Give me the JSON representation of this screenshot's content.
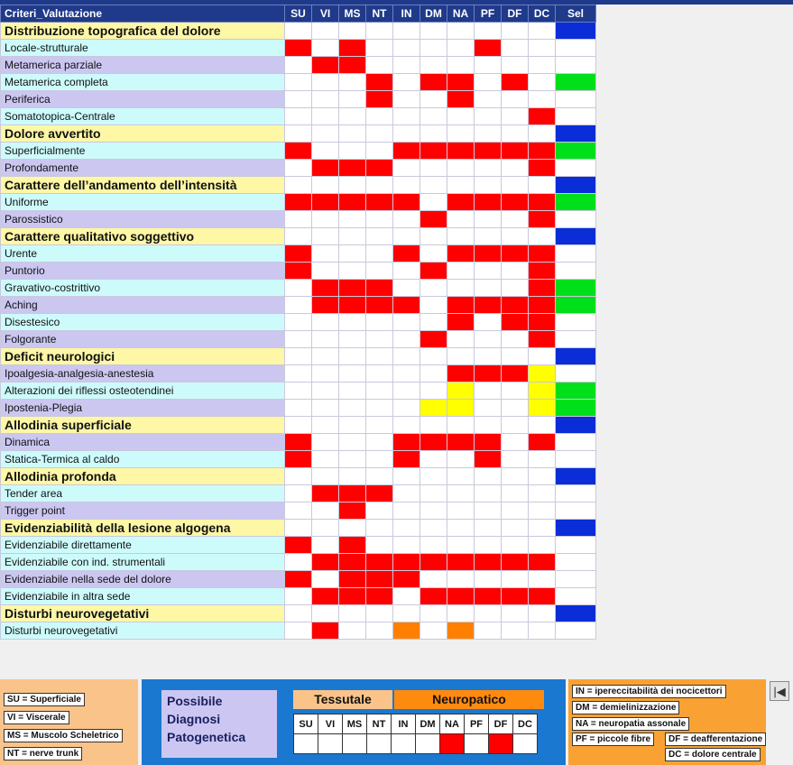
{
  "header": {
    "criteria_label": "Criteri_Valutazione",
    "columns": [
      "SU",
      "VI",
      "MS",
      "NT",
      "IN",
      "DM",
      "NA",
      "PF",
      "DF",
      "DC",
      "Sel"
    ]
  },
  "rows": [
    {
      "label": "Distribuzione topografica del dolore",
      "type": "section",
      "cells": "..........B"
    },
    {
      "label": "Locale-strutturale",
      "type": "a",
      "cells": "R.R....R..."
    },
    {
      "label": "Metamerica parziale",
      "type": "b",
      "cells": ".RR........"
    },
    {
      "label": "Metamerica completa",
      "type": "a",
      "cells": "...R.RR.R.G"
    },
    {
      "label": "Periferica",
      "type": "b",
      "cells": "...R..R...."
    },
    {
      "label": "Somatotopica-Centrale",
      "type": "a",
      "cells": ".........R."
    },
    {
      "label": "Dolore avvertito",
      "type": "section",
      "cells": "..........B"
    },
    {
      "label": "Superficialmente",
      "type": "a",
      "cells": "R...RRRRRRG"
    },
    {
      "label": "Profondamente",
      "type": "b",
      "cells": ".RRR.....R."
    },
    {
      "label": "Carattere dell’andamento dell’intensità",
      "type": "section",
      "cells": "..........B"
    },
    {
      "label": "Uniforme",
      "type": "a",
      "cells": "RRRRR.RRRRG"
    },
    {
      "label": "Parossistico",
      "type": "b",
      "cells": ".....R...R."
    },
    {
      "label": "Carattere qualitativo soggettivo",
      "type": "section",
      "cells": "..........B"
    },
    {
      "label": "Urente",
      "type": "a",
      "cells": "R...R.RRRR."
    },
    {
      "label": "Puntorio",
      "type": "b",
      "cells": "R....R...R."
    },
    {
      "label": "Gravativo-costrittivo",
      "type": "a",
      "cells": ".RRR.....RG"
    },
    {
      "label": "Aching",
      "type": "b",
      "cells": ".RRRR.RRRRG"
    },
    {
      "label": "Disestesico",
      "type": "a",
      "cells": "......R.RR."
    },
    {
      "label": "Folgorante",
      "type": "b",
      "cells": ".....R...R."
    },
    {
      "label": "Deficit neurologici",
      "type": "section",
      "cells": "..........B"
    },
    {
      "label": "Ipoalgesia-analgesia-anestesia",
      "type": "b",
      "cells": "......RRRY."
    },
    {
      "label": "Alterazioni dei riflessi osteotendinei",
      "type": "a",
      "cells": "......Y..YG"
    },
    {
      "label": "Ipostenia-Plegia",
      "type": "b",
      "cells": ".....YY..YG"
    },
    {
      "label": "Allodinia superficiale",
      "type": "section",
      "cells": "..........B"
    },
    {
      "label": "Dinamica",
      "type": "b",
      "cells": "R...RRRR.R."
    },
    {
      "label": "Statica-Termica al caldo",
      "type": "a",
      "cells": "R...R..R..."
    },
    {
      "label": "Allodinia profonda",
      "type": "section",
      "cells": "..........B"
    },
    {
      "label": "Tender area",
      "type": "a",
      "cells": ".RRR......."
    },
    {
      "label": "Trigger point",
      "type": "b",
      "cells": "..R........"
    },
    {
      "label": "Evidenziabilità della lesione algogena",
      "type": "section",
      "cells": "..........B"
    },
    {
      "label": "Evidenziabile direttamente",
      "type": "a",
      "cells": "R.R........"
    },
    {
      "label": "Evidenziabile con ind. strumentali",
      "type": "a",
      "cells": ".RRRRRRRRR."
    },
    {
      "label": "Evidenziabile nella sede del dolore",
      "type": "b",
      "cells": "R.RRR......"
    },
    {
      "label": "Evidenziabile in altra sede",
      "type": "a",
      "cells": ".RRR.RRRRR."
    },
    {
      "label": "Disturbi neurovegetativi",
      "type": "section",
      "cells": "..........B"
    },
    {
      "label": "Disturbi neurovegetativi",
      "type": "a",
      "cells": ".R..O.O...."
    }
  ],
  "legend_left": {
    "su": "SU = Superficiale",
    "vi": "VI = Viscerale",
    "ms": "MS = Muscolo Scheletrico",
    "nt": "NT = nerve trunk"
  },
  "diagnosis": {
    "title": "Possibile Diagnosi Patogenetica",
    "tessutale": "Tessutale",
    "neuropatico": "Neuropatico",
    "columns": [
      "SU",
      "VI",
      "MS",
      "NT",
      "IN",
      "DM",
      "NA",
      "PF",
      "DF",
      "DC"
    ],
    "result": "......R.R."
  },
  "legend_right": {
    "in": "IN = ipereccitabilità dei nocicettori",
    "dm": "DM = demielinizzazione",
    "na": "NA = neuropatia assonale",
    "pf": "PF = piccole fibre",
    "df": "DF = deafferentazione",
    "dc": "DC = dolore centrale"
  },
  "nav": {
    "first_icon": "first-page-icon",
    "first_glyph": "|◀"
  },
  "colors": {
    "header_bg": "#1f3a8a",
    "section_bg": "#fdf7a6",
    "row_a_bg": "#cdfbfb",
    "row_b_bg": "#cbc7f1",
    "red": "#ff0000",
    "yellow": "#ffff00",
    "orange": "#ff8000",
    "blue": "#0a2dd8",
    "green": "#00e01a"
  }
}
